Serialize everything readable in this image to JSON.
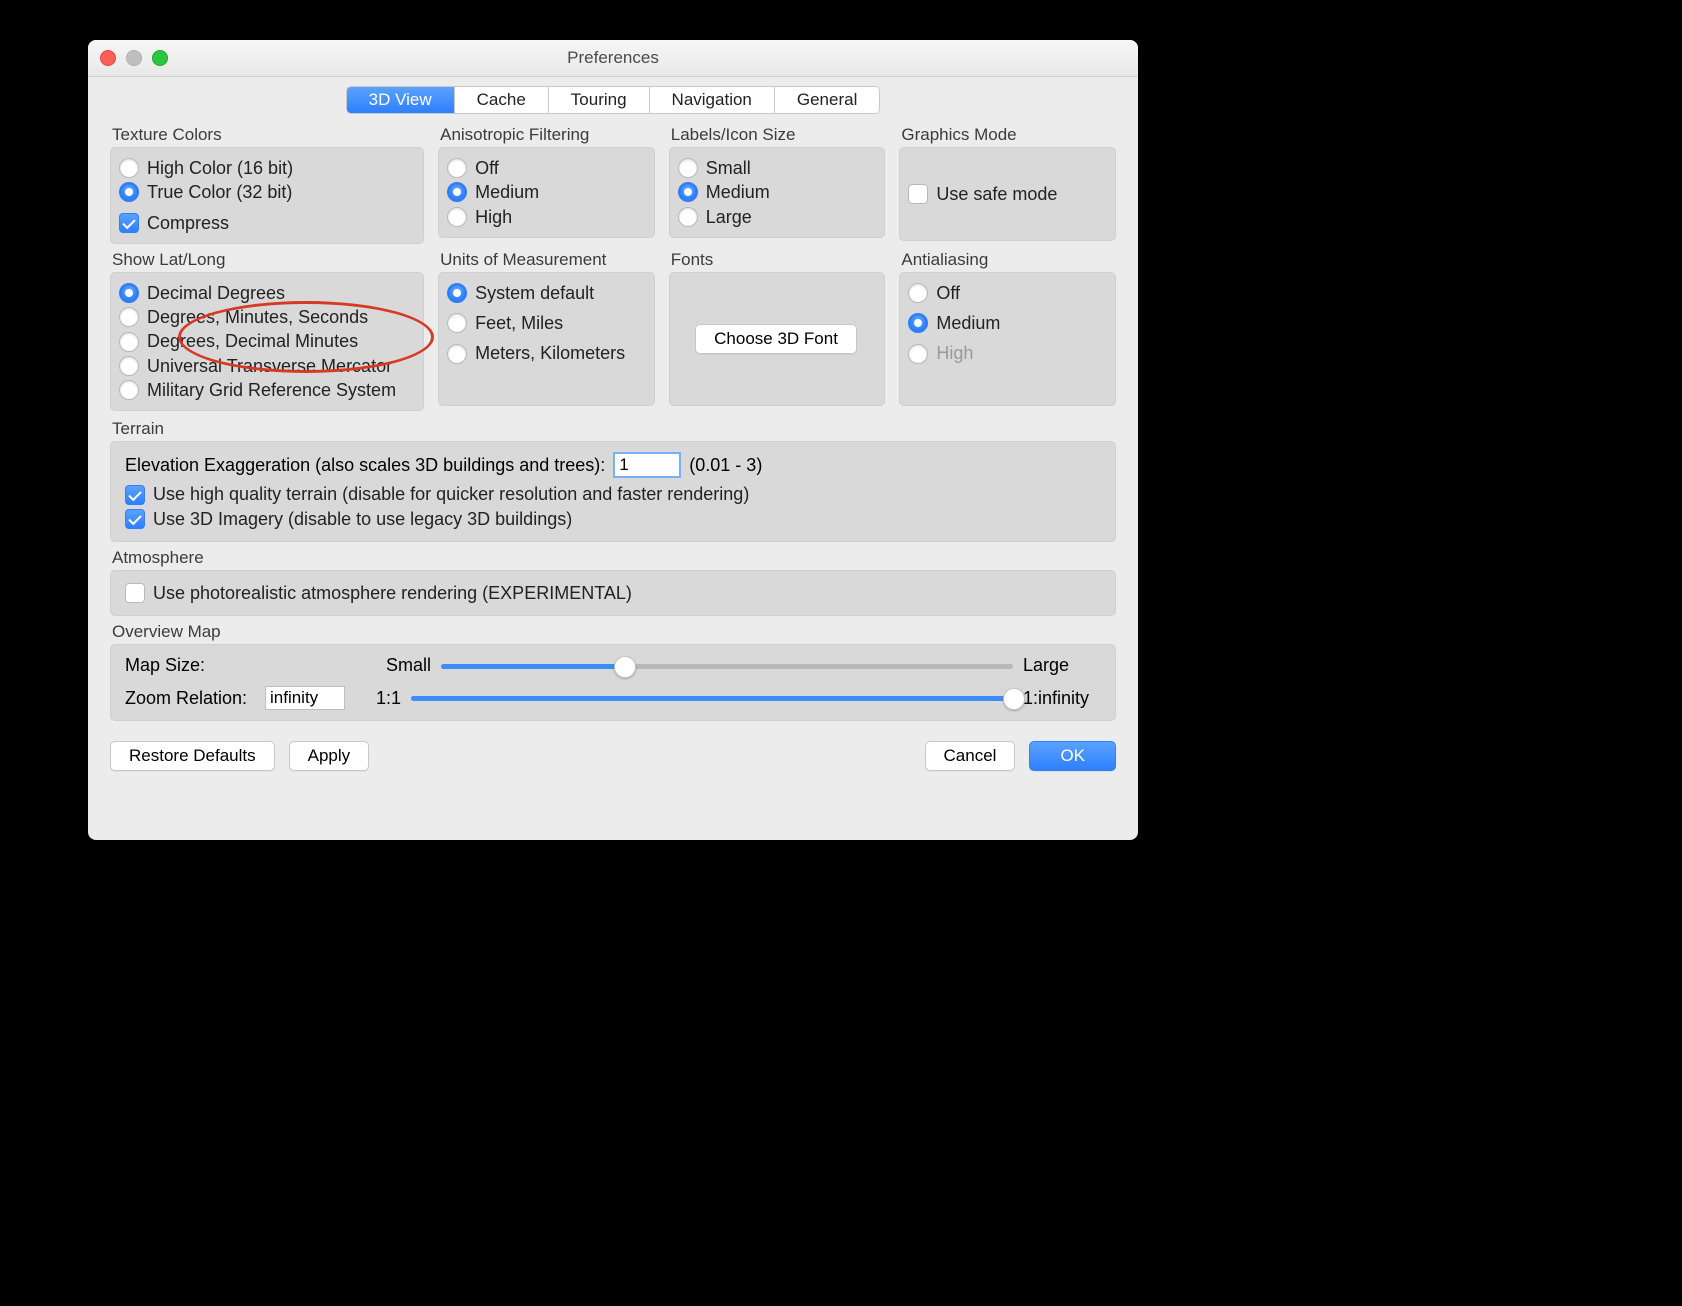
{
  "window": {
    "title": "Preferences"
  },
  "tabs": [
    "3D View",
    "Cache",
    "Touring",
    "Navigation",
    "General"
  ],
  "active_tab": 0,
  "groups": {
    "textureColors": {
      "title": "Texture Colors",
      "options": [
        "High Color (16 bit)",
        "True Color (32 bit)"
      ],
      "selected": 1,
      "compress_label": "Compress",
      "compress_checked": true
    },
    "anisotropic": {
      "title": "Anisotropic Filtering",
      "options": [
        "Off",
        "Medium",
        "High"
      ],
      "selected": 1
    },
    "labelsIcon": {
      "title": "Labels/Icon Size",
      "options": [
        "Small",
        "Medium",
        "Large"
      ],
      "selected": 1
    },
    "graphics": {
      "title": "Graphics Mode",
      "safe_mode_label": "Use safe mode",
      "safe_mode_checked": false
    },
    "latlong": {
      "title": "Show Lat/Long",
      "options": [
        "Decimal Degrees",
        "Degrees, Minutes, Seconds",
        "Degrees, Decimal Minutes",
        "Universal Transverse Mercator",
        "Military Grid Reference System"
      ],
      "selected": 0
    },
    "units": {
      "title": "Units of Measurement",
      "options": [
        "System default",
        "Feet, Miles",
        "Meters, Kilometers"
      ],
      "selected": 0
    },
    "fonts": {
      "title": "Fonts",
      "button": "Choose 3D Font"
    },
    "antialias": {
      "title": "Antialiasing",
      "options": [
        "Off",
        "Medium",
        "High"
      ],
      "selected": 1,
      "disabled_index": 2
    },
    "terrain": {
      "title": "Terrain",
      "elev_label": "Elevation Exaggeration (also scales 3D buildings and trees):",
      "elev_value": "1",
      "elev_range": "(0.01 - 3)",
      "hq_label": "Use high quality terrain (disable for quicker resolution and faster rendering)",
      "hq_checked": true,
      "imagery_label": "Use 3D Imagery (disable to use legacy 3D buildings)",
      "imagery_checked": true
    },
    "atmosphere": {
      "title": "Atmosphere",
      "pr_label": "Use photorealistic atmosphere rendering (EXPERIMENTAL)",
      "pr_checked": false
    },
    "overview": {
      "title": "Overview Map",
      "mapsize_label": "Map Size:",
      "small": "Small",
      "large": "Large",
      "mapsize_pct": 32,
      "zoom_label": "Zoom Relation:",
      "zoom_value": "infinity",
      "one_to_one": "1:1",
      "one_to_inf": "1:infinity",
      "zoom_pct": 100
    }
  },
  "buttons": {
    "restore": "Restore Defaults",
    "apply": "Apply",
    "cancel": "Cancel",
    "ok": "OK"
  }
}
